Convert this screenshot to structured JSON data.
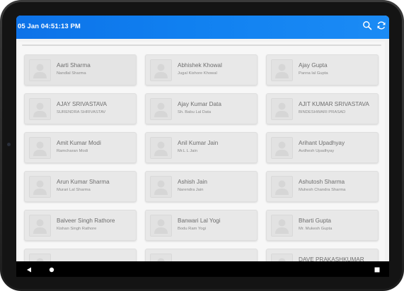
{
  "status_bar": {
    "time": "05 Jan 04:51:13 PM"
  },
  "icons": {
    "search": "search-icon",
    "refresh": "refresh-icon"
  },
  "colors": {
    "topbar": "#1080f0",
    "card": "#e8e8e8",
    "nav": "#000000"
  },
  "cards": [
    {
      "name": "Aarti  Sharma",
      "sub": "Nandlal Sharma"
    },
    {
      "name": "Abhishek  Khowal",
      "sub": "Jugal Kishore Khowal"
    },
    {
      "name": "Ajay  Gupta",
      "sub": "Panna lal Gupta"
    },
    {
      "name": "AJAY  SRIVASTAVA",
      "sub": "SURENDRA SHRIVASTAV"
    },
    {
      "name": "Ajay Kumar Data",
      "sub": "Sh. Babu Lal Data"
    },
    {
      "name": "AJIT KUMAR SRIVASTAVA",
      "sub": "BINDESHWARI PRASAD"
    },
    {
      "name": "Amit Kumar Modi",
      "sub": "Ramcharan Modi"
    },
    {
      "name": "Anil Kumar Jain",
      "sub": "Mr.L L Jain"
    },
    {
      "name": "Arihant  Upadhyay",
      "sub": "Avdhesh Upadhyay"
    },
    {
      "name": "Arun Kumar Sharma",
      "sub": "Murari Lal Sharma"
    },
    {
      "name": "Ashish  Jain",
      "sub": "Narendra Jain"
    },
    {
      "name": "Ashutosh  Sharma",
      "sub": "Muhesh Chandra Sharma"
    },
    {
      "name": "Balveer Singh Rathore",
      "sub": "Kishan Singh Rathore"
    },
    {
      "name": "Banwari Lal Yogi",
      "sub": "Bodu Ram Yogi"
    },
    {
      "name": "Bharti  Gupta",
      "sub": "Mr. Mukesh Gupta"
    },
    {
      "name": "",
      "sub": ""
    },
    {
      "name": "",
      "sub": ""
    },
    {
      "name": "DAVE PRAKASHKUMAR",
      "sub": ""
    }
  ],
  "nav": {
    "back": "back-icon",
    "home": "home-icon",
    "recents": "recents-icon"
  }
}
